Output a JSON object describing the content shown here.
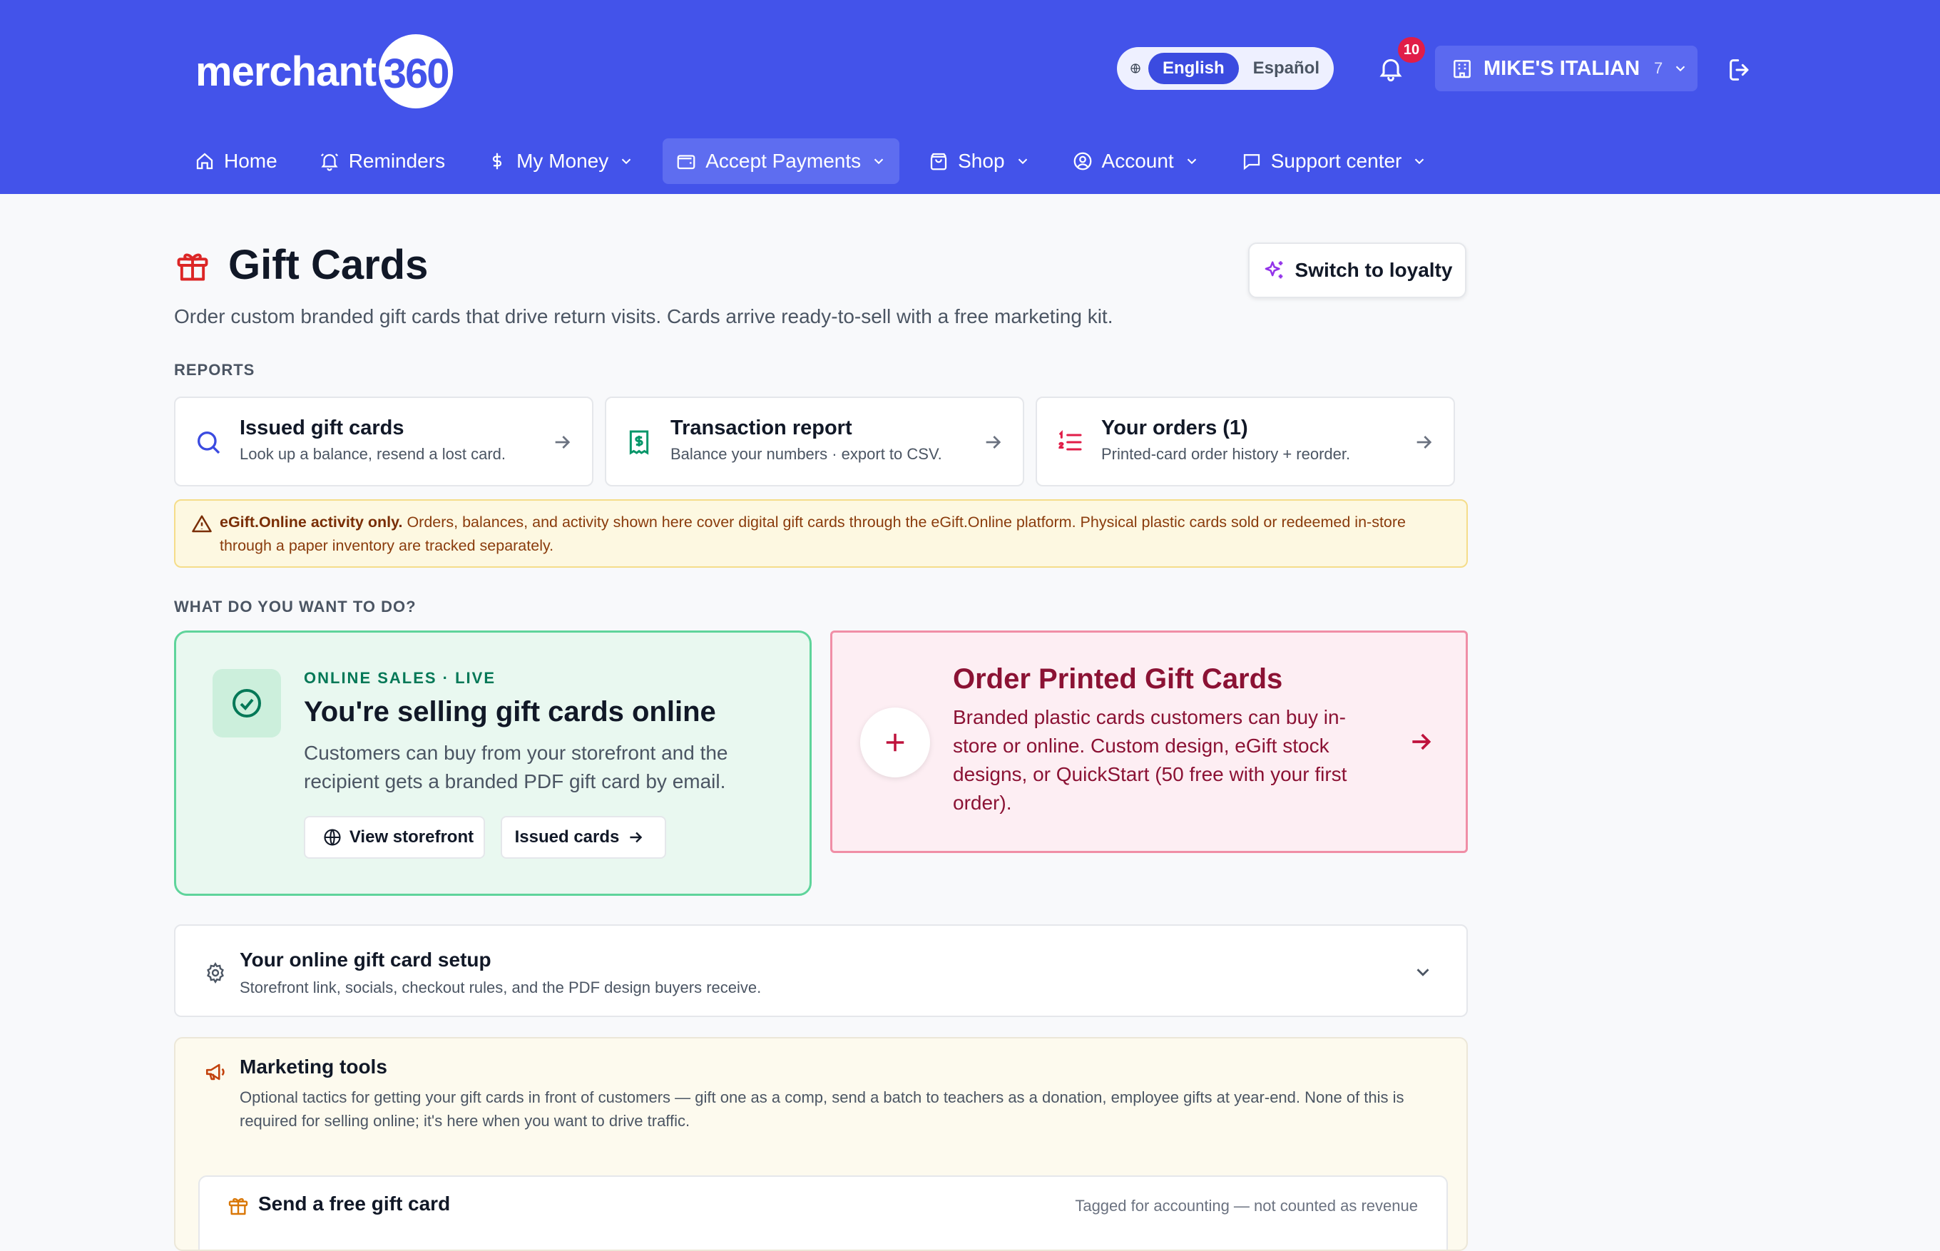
{
  "brand": {
    "logo_text": "merchant",
    "logo_number": "360"
  },
  "header": {
    "lang_active": "English",
    "lang_other": "Español",
    "notification_count": "10",
    "merchant_name": "MIKE'S ITALIAN",
    "merchant_count": "7"
  },
  "nav": {
    "items": [
      {
        "label": "Home"
      },
      {
        "label": "Reminders"
      },
      {
        "label": "My Money"
      },
      {
        "label": "Accept Payments"
      },
      {
        "label": "Shop"
      },
      {
        "label": "Account"
      },
      {
        "label": "Support center"
      }
    ]
  },
  "page": {
    "title": "Gift Cards",
    "subtitle": "Order custom branded gift cards that drive return visits. Cards arrive ready-to-sell with a free marketing kit.",
    "switch_button": "Switch to loyalty"
  },
  "reports": {
    "label": "REPORTS",
    "items": [
      {
        "title": "Issued gift cards",
        "subtitle": "Look up a balance, resend a lost card."
      },
      {
        "title": "Transaction report",
        "subtitle": "Balance your numbers · export to CSV."
      },
      {
        "title": "Your orders (1)",
        "subtitle": "Printed-card order history + reorder."
      }
    ]
  },
  "alert": {
    "bold": "eGift.Online activity only.",
    "text": " Orders, balances, and activity shown here cover digital gift cards through the eGift.Online platform. Physical plastic cards sold or redeemed in-store through a paper inventory are tracked separately."
  },
  "actions": {
    "label": "WHAT DO YOU WANT TO DO?",
    "online": {
      "eyebrow": "ONLINE SALES · LIVE",
      "title": "You're selling gift cards online",
      "description": "Customers can buy from your storefront and the recipient gets a branded PDF gift card by email.",
      "view_storefront": "View storefront",
      "issued_cards": "Issued cards"
    },
    "printed": {
      "title": "Order Printed Gift Cards",
      "description": "Branded plastic cards customers can buy in-store or online. Custom design, eGift stock designs, or QuickStart (50 free with your first order)."
    }
  },
  "setup": {
    "title": "Your online gift card setup",
    "subtitle": "Storefront link, socials, checkout rules, and the PDF design buyers receive."
  },
  "marketing": {
    "title": "Marketing tools",
    "subtitle": "Optional tactics for getting your gift cards in front of customers — gift one as a comp, send a batch to teachers as a donation, employee gifts at year-end. None of this is required for selling online; it's here when you want to drive traffic.",
    "free_card_title": "Send a free gift card",
    "free_card_note": "Tagged for accounting — not counted as revenue"
  },
  "colors": {
    "header_bg": "#4353ea",
    "green_accent": "#047857",
    "pink_accent": "#8b1234",
    "alert_text": "#8a3b0c"
  }
}
